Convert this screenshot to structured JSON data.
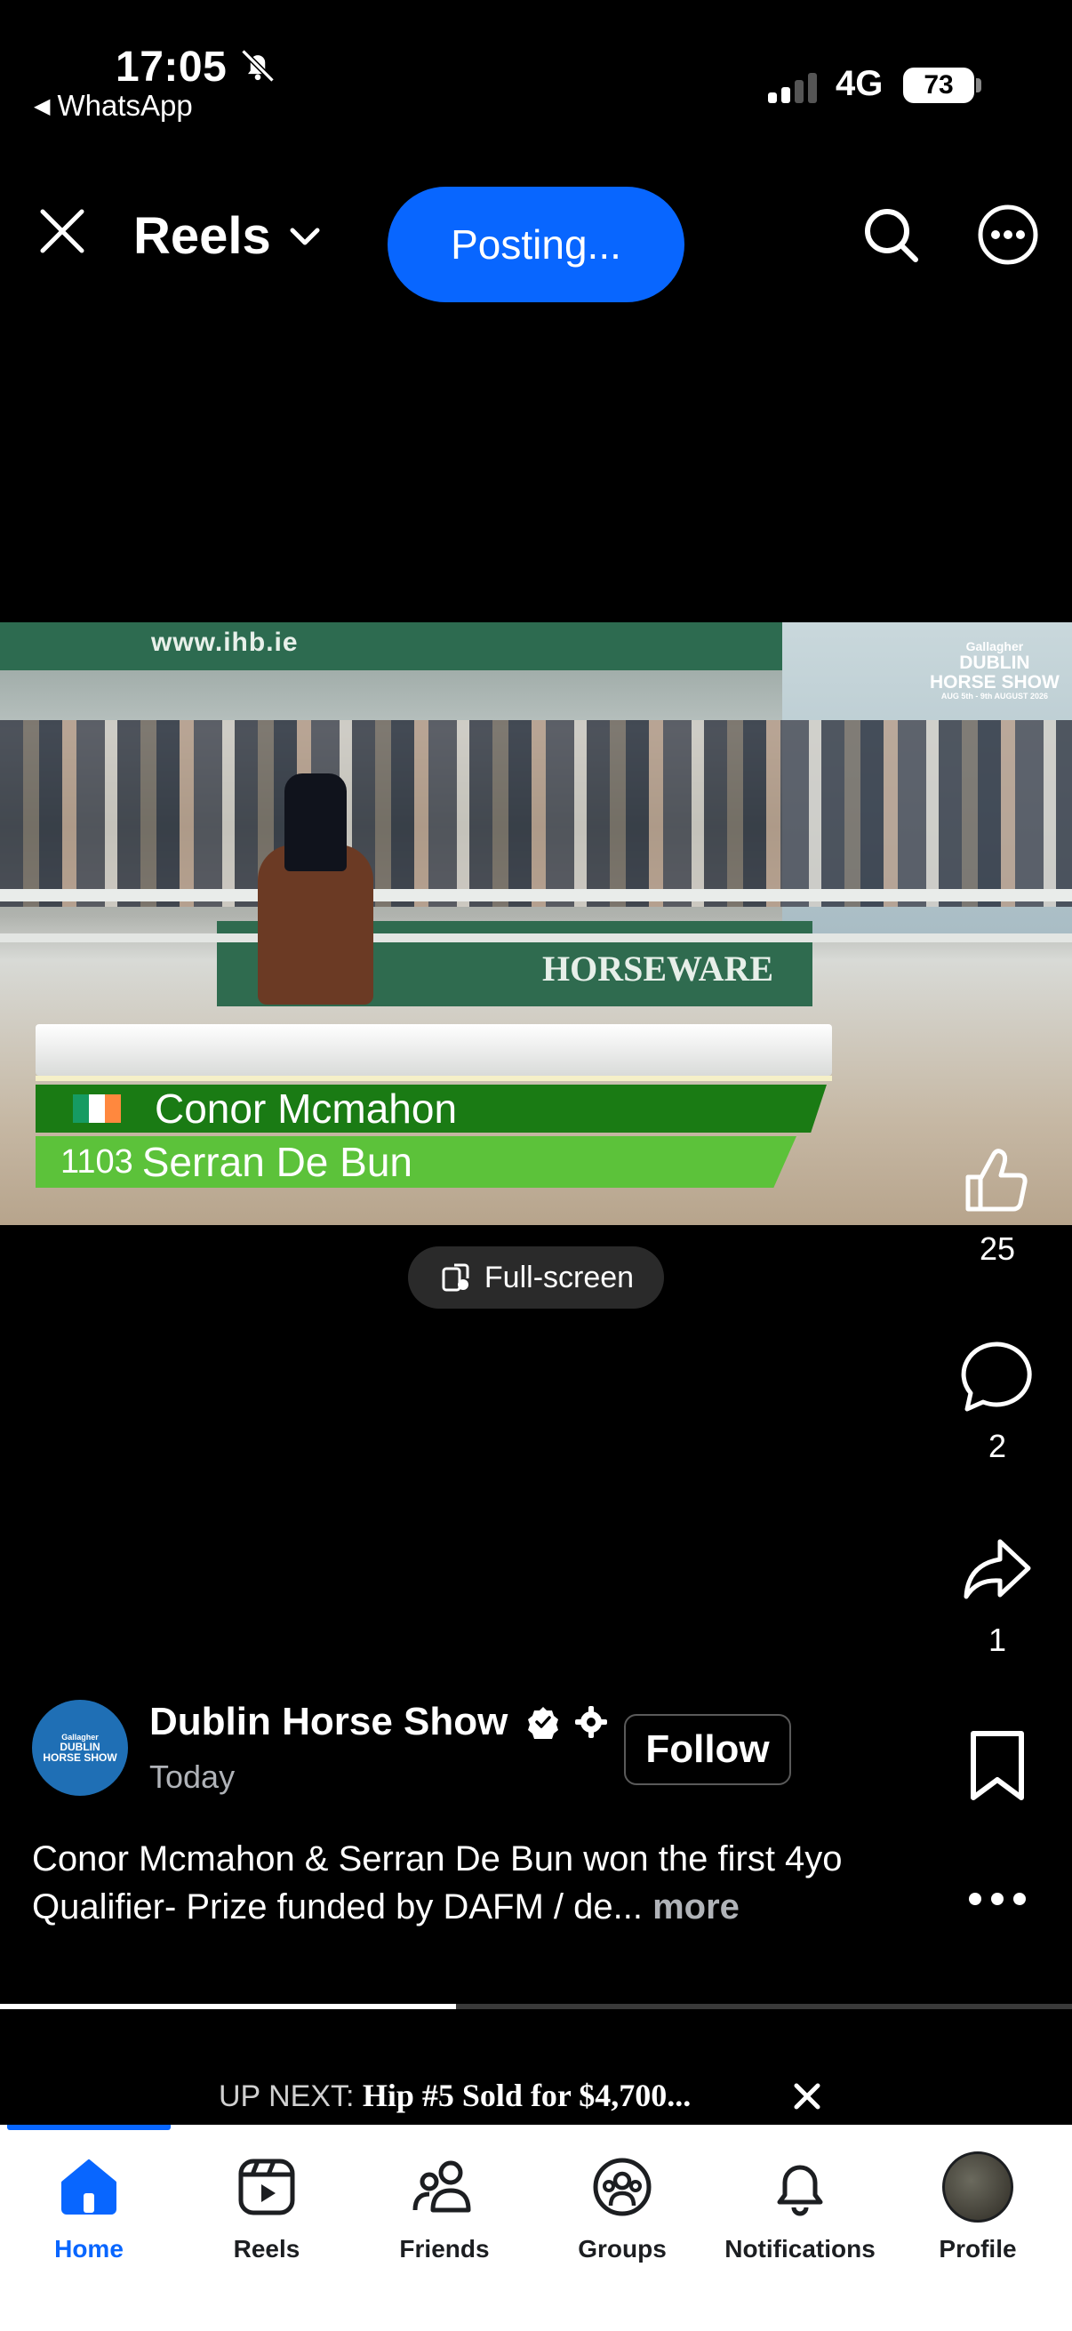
{
  "status_bar": {
    "time": "17:05",
    "back_app": "WhatsApp",
    "network": "4G",
    "battery": "73"
  },
  "header": {
    "title": "Reels",
    "posting_label": "Posting..."
  },
  "video": {
    "banner_url": "www.ihb.ie",
    "logo": {
      "line1": "Gallagher",
      "line2": "DUBLIN",
      "line3": "HORSE SHOW",
      "line4": "AUG 5th - 9th AUGUST 2026"
    },
    "board_text": "HORSEWARE",
    "rider_name": "Conor Mcmahon",
    "horse_number": "1103",
    "horse_name": "Serran De Bun"
  },
  "fullscreen_label": "Full-screen",
  "actions": {
    "like_count": "25",
    "comment_count": "2",
    "share_count": "1"
  },
  "post": {
    "author": "Dublin Horse Show",
    "avatar_line1": "Gallagher",
    "avatar_line2": "DUBLIN",
    "avatar_line3": "HORSE SHOW",
    "time": "Today",
    "follow_label": "Follow",
    "caption": "Conor Mcmahon & Serran De Bun won the first 4yo Qualifier- Prize funded by DAFM / de...",
    "more_label": "more"
  },
  "progress": {
    "fraction": 0.425
  },
  "up_next": {
    "label": "UP NEXT:",
    "title": "Hip #5  Sold for $4,700..."
  },
  "bottom_nav": {
    "tabs": [
      {
        "label": "Home",
        "icon": "home-icon",
        "active": true
      },
      {
        "label": "Reels",
        "icon": "reels-icon"
      },
      {
        "label": "Friends",
        "icon": "friends-icon"
      },
      {
        "label": "Groups",
        "icon": "groups-icon"
      },
      {
        "label": "Notifications",
        "icon": "bell-icon"
      },
      {
        "label": "Profile",
        "icon": "profile-avatar"
      }
    ]
  },
  "colors": {
    "accent": "#0866ff",
    "background": "#000000",
    "rider_bar": "#1a7b14",
    "horse_bar": "#5cc23a"
  }
}
